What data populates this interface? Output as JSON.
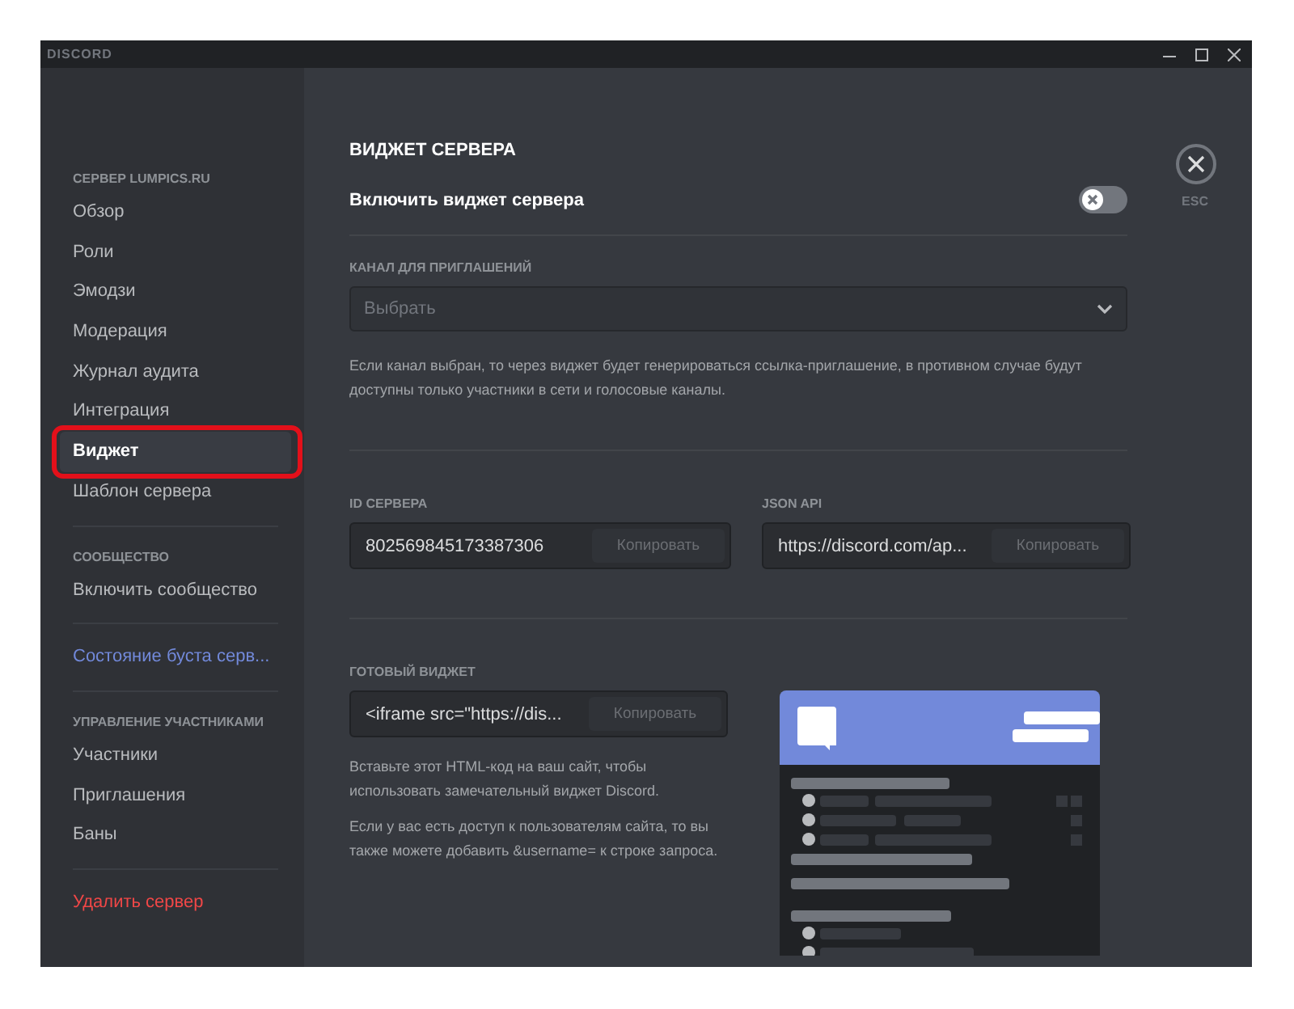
{
  "window": {
    "title": "DISCORD"
  },
  "sidebar": [
    {
      "kind": "header",
      "label": "СЕРВЕР LUMPICS.RU"
    },
    {
      "kind": "item",
      "label": "Обзор",
      "selected": false,
      "annotated": false
    },
    {
      "kind": "item",
      "label": "Роли",
      "selected": false,
      "annotated": false
    },
    {
      "kind": "item",
      "label": "Эмодзи",
      "selected": false,
      "annotated": false
    },
    {
      "kind": "item",
      "label": "Модерация",
      "selected": false,
      "annotated": false
    },
    {
      "kind": "item",
      "label": "Журнал аудита",
      "selected": false,
      "annotated": false
    },
    {
      "kind": "item",
      "label": "Интеграция",
      "selected": false,
      "annotated": false
    },
    {
      "kind": "item",
      "label": "Виджет",
      "selected": true,
      "annotated": true
    },
    {
      "kind": "item",
      "label": "Шаблон сервера",
      "selected": false,
      "annotated": false
    },
    {
      "kind": "divider"
    },
    {
      "kind": "header",
      "label": "СООБЩЕСТВО"
    },
    {
      "kind": "item",
      "label": "Включить сообщество",
      "selected": false,
      "annotated": false
    },
    {
      "kind": "divider"
    },
    {
      "kind": "link",
      "label": "Состояние буста серв..."
    },
    {
      "kind": "divider"
    },
    {
      "kind": "header",
      "label": "УПРАВЛЕНИЕ УЧАСТНИКАМИ"
    },
    {
      "kind": "item",
      "label": "Участники",
      "selected": false,
      "annotated": false
    },
    {
      "kind": "item",
      "label": "Приглашения",
      "selected": false,
      "annotated": false
    },
    {
      "kind": "item",
      "label": "Баны",
      "selected": false,
      "annotated": false
    },
    {
      "kind": "divider"
    },
    {
      "kind": "danger",
      "label": "Удалить сервер"
    }
  ],
  "content": {
    "title": "ВИДЖЕТ СЕРВЕРА",
    "toggle": {
      "label": "Включить виджет сервера",
      "on": false
    },
    "invite_channel": {
      "label": "КАНАЛ ДЛЯ ПРИГЛАШЕНИЙ",
      "placeholder": "Выбрать",
      "note": "Если канал выбран, то через виджет будет генерироваться ссылка-приглашение, в противном случае будут доступны только участники в сети и голосовые каналы."
    },
    "server_id": {
      "label": "ID СЕРВЕРА",
      "value": "802569845173387306",
      "button": "Копировать"
    },
    "json_api": {
      "label": "JSON API",
      "value": "https://discord.com/ap...",
      "button": "Копировать"
    },
    "ready_widget": {
      "label": "ГОТОВЫЙ ВИДЖЕТ",
      "value": "<iframe src=\"https://dis...",
      "button": "Копировать",
      "notes": [
        "Вставьте этот HTML-код на ваш сайт, чтобы использовать замечательный виджет Discord.",
        "Если у вас есть доступ к пользователям сайта, то вы также можете добавить &username= к строке запроса."
      ]
    },
    "close": {
      "label": "ESC"
    }
  }
}
